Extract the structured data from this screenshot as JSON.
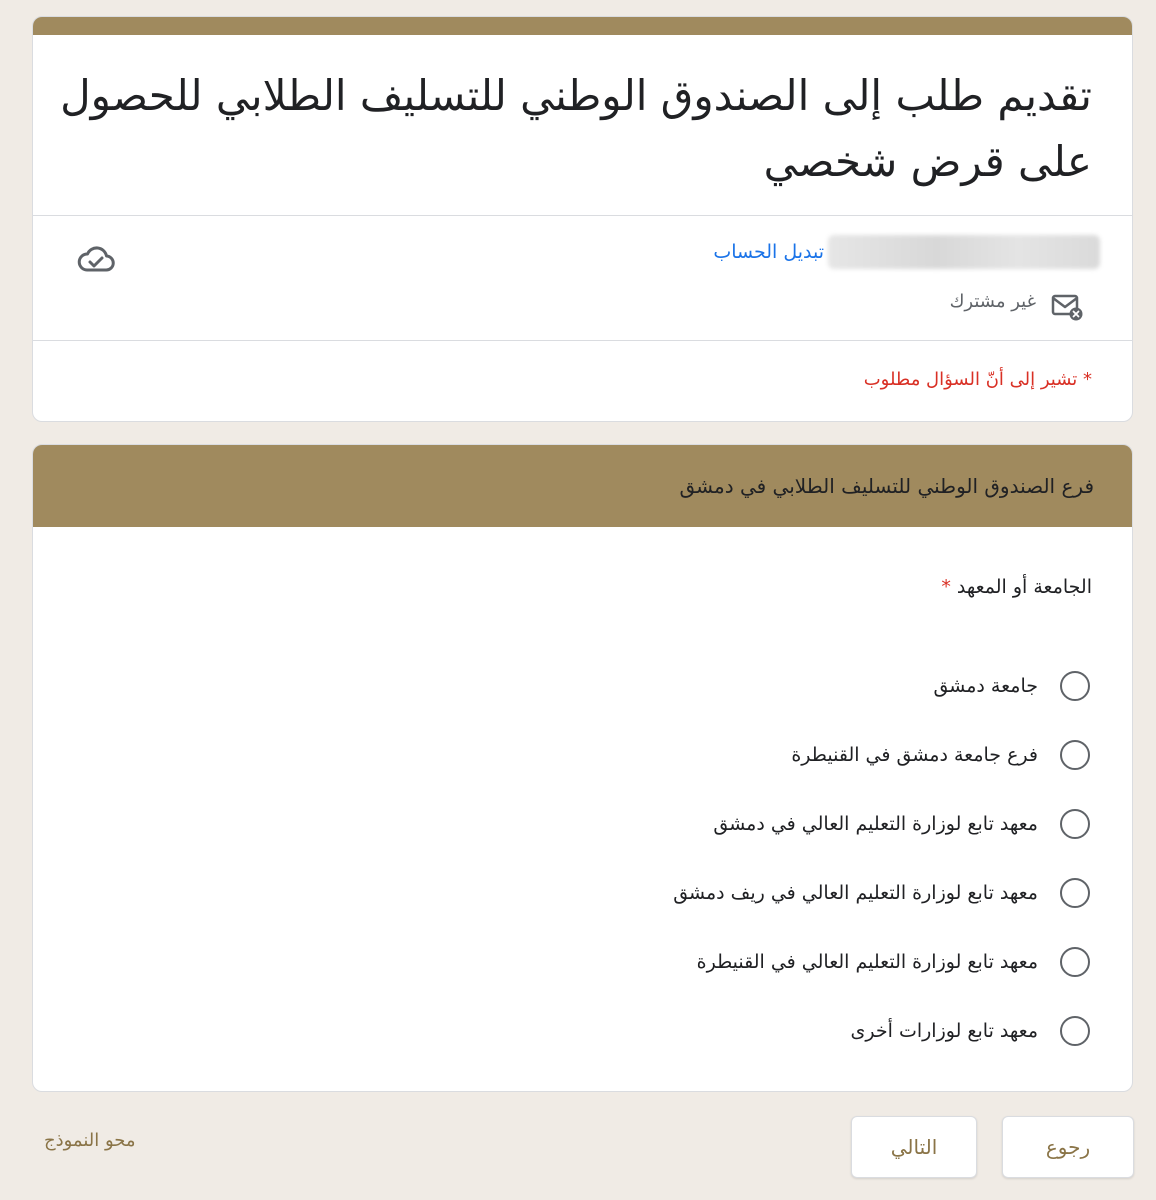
{
  "form": {
    "title": "تقديم طلب إلى الصندوق الوطني للتسليف الطلابي للحصول على قرض شخصي",
    "switch_account": "تبديل الحساب",
    "not_shared": "غير مشترك",
    "required_note": "* تشير إلى أنّ السؤال مطلوب"
  },
  "section": {
    "title": "فرع الصندوق الوطني للتسليف الطلابي في دمشق",
    "question": {
      "title": "الجامعة أو المعهد",
      "required_marker": "*",
      "options": [
        {
          "label": "جامعة دمشق"
        },
        {
          "label": "فرع جامعة دمشق في القنيطرة"
        },
        {
          "label": "معهد تابع لوزارة التعليم العالي في دمشق"
        },
        {
          "label": "معهد تابع لوزارة التعليم العالي في ريف دمشق"
        },
        {
          "label": "معهد تابع لوزارة التعليم العالي في القنيطرة"
        },
        {
          "label": "معهد تابع لوزارات أخرى"
        }
      ]
    }
  },
  "footer": {
    "back_label": "رجوع",
    "next_label": "التالي",
    "clear_label": "محو النموذج"
  },
  "icons": {
    "cloud": "cloud-check-icon",
    "mail": "mail-not-shared-icon"
  },
  "colors": {
    "accent": "#a08a5e",
    "background": "#f0ebe5",
    "link": "#1a73e8",
    "required": "#d93025",
    "button_text": "#8a7447"
  }
}
